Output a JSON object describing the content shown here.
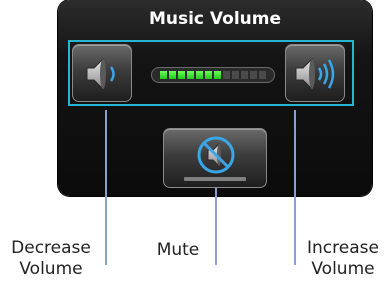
{
  "dialog": {
    "title": "Music Volume"
  },
  "volume": {
    "level": 0.58,
    "total_segments": 12,
    "lit_segments": 7
  },
  "buttons": {
    "decrease_icon": "speaker-decrease-icon",
    "increase_icon": "speaker-increase-icon",
    "mute_icon": "speaker-muted-icon"
  },
  "callouts": {
    "decrease": "Decrease Volume",
    "mute": "Mute",
    "increase": "Increase Volume"
  },
  "colors": {
    "selection_border": "#26b6d2",
    "meter_on": "#3ddd2f",
    "callout_line": "#8a9fd3"
  }
}
